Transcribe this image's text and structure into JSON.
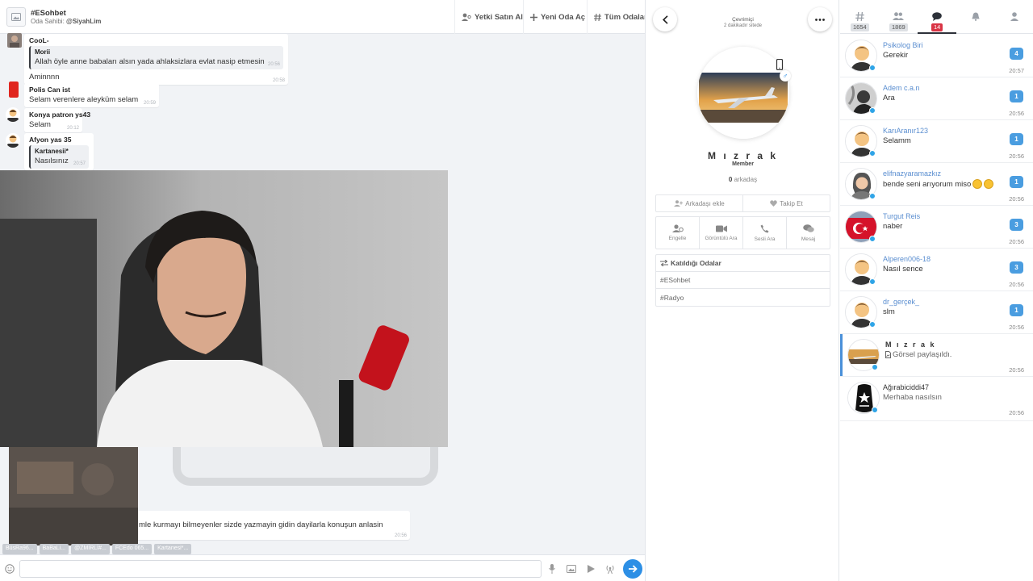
{
  "room": {
    "name": "#ESohbet",
    "owner_label": "Oda Sahibi:",
    "owner_name": "@SiyahLim"
  },
  "header_actions": {
    "buy_authority": "Yetki Satın Al",
    "new_room": "Yeni Oda Aç",
    "all_rooms": "Tüm Odalar"
  },
  "messages": [
    {
      "user": "CooL-",
      "quote_user": "Morii",
      "quote_text": "Allah öyle anne babaları alsın yada ahlaksizlara evlat nasip etmesin",
      "quote_time": "20:56",
      "text": "Aminnnn",
      "time": "20:58"
    },
    {
      "user": "Polis Can ist",
      "text": "Selam verenlere aleyküm selam",
      "time": "20:59"
    },
    {
      "user": "Konya patron ys43",
      "text": "Selam",
      "time": "20:12"
    },
    {
      "user": "Afyon yas 35",
      "quote_user": "Kartanesii*",
      "quote_text": "Nasılsınız",
      "quote_time": "20:57"
    },
    {
      "text": "mle kurmayı bilmeyenler sizde yazmayin gidin dayilarla konuşun anlasin",
      "time": "20:56"
    }
  ],
  "typing_tags": [
    "BüsRa96...",
    "BaBaLi...",
    "@ZMİRLİ#...",
    "FCEdo 065...",
    "Kartanesi*..."
  ],
  "composer": {
    "placeholder": ""
  },
  "profile": {
    "status": "Çevrimiçi",
    "last_seen": "2 dakikadır sitede",
    "name": "M ı z r a k",
    "rank": "Member",
    "friend_count": "0",
    "friends_label": "arkadaş",
    "add_friend": "Arkadaşı ekle",
    "follow": "Takip Et",
    "block": "Engelle",
    "video_call": "Görüntülü Ara",
    "voice_call": "Sesli Ara",
    "message": "Mesaj",
    "joined_rooms_title": "Katıldığı Odalar",
    "joined_rooms": [
      "#ESohbet",
      "#Radyo"
    ]
  },
  "tabs": [
    {
      "icon": "hash-icon",
      "count": "1654"
    },
    {
      "icon": "users-icon",
      "count": "1869"
    },
    {
      "icon": "chat-icon",
      "count": "14"
    },
    {
      "icon": "bell-icon",
      "count": ""
    },
    {
      "icon": "user-icon",
      "count": ""
    }
  ],
  "conversations": [
    {
      "name": "Psikolog Biri",
      "message": "Gerekir",
      "badge": "4",
      "time": "20:57"
    },
    {
      "name": "Adem c.a.n",
      "message": "Ara",
      "badge": "1",
      "time": "20:56"
    },
    {
      "name": "KarıAranır123",
      "message": "Selamm",
      "badge": "1",
      "time": "20:56"
    },
    {
      "name": "elifnazyaramazkız",
      "message": "bende seni arıyorum miso",
      "badge": "1",
      "time": "20:56"
    },
    {
      "name": "Turgut Reis",
      "message": "naber",
      "badge": "3",
      "time": "20:56"
    },
    {
      "name": "Alperen006-18",
      "message": "Nasıl sence",
      "badge": "3",
      "time": "20:56"
    },
    {
      "name": "dr_gerçek_",
      "message": "slm",
      "badge": "1",
      "time": "20:56"
    },
    {
      "name": "M ı z r a k",
      "message": "Görsel paylaşıldı.",
      "badge": "",
      "time": "20:56"
    },
    {
      "name": "Ağırabiciddi47",
      "message": "Merhaba nasılsın",
      "badge": "",
      "time": "20:56"
    }
  ],
  "colors": {
    "accent": "#2d8fe5",
    "badge_blue": "#4a9de0",
    "badge_red": "#d93445",
    "username_blue": "#5a8ed0",
    "online_dot": "#2fa4e7"
  }
}
